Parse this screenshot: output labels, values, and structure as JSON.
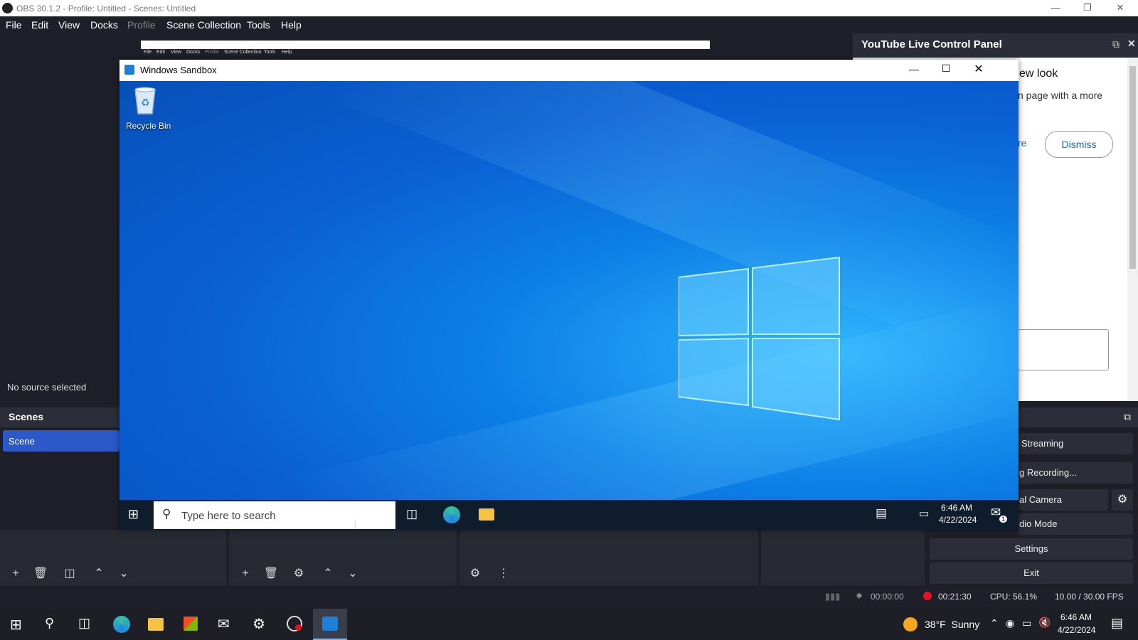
{
  "obs": {
    "window_title": "OBS 30.1.2 - Profile: Untitled - Scenes: Untitled",
    "menu": [
      "File",
      "Edit",
      "View",
      "Docks",
      "Profile",
      "Scene Collection",
      "Tools",
      "Help"
    ],
    "preview_menu": [
      "File",
      "Edit",
      "View",
      "Docks",
      "Profile",
      "Scene Collection",
      "Tools",
      "Help"
    ],
    "no_source": "No source selected",
    "scenes_title": "Scenes",
    "scene_item": "Scene",
    "youtube_panel": {
      "title": "YouTube Live Control Panel",
      "headline_partial": "ew look",
      "text_partial": "n page with a more",
      "link_partial": "re",
      "dismiss": "Dismiss"
    },
    "controls": {
      "streaming": "Streaming",
      "recording": "g Recording...",
      "virtual_camera": "al Camera",
      "studio_mode": "dio Mode",
      "settings": "Settings",
      "exit": "Exit"
    },
    "status": {
      "stream_time": "00:00:00",
      "rec_time": "00:21:30",
      "cpu": "CPU: 56.1%",
      "fps": "10.00 / 30.00 FPS"
    }
  },
  "sandbox": {
    "title": "Windows Sandbox",
    "recycle_bin": "Recycle Bin",
    "search_placeholder": "Type here to search",
    "time": "6:46 AM",
    "date": "4/22/2024",
    "notification_count": "1"
  },
  "host_taskbar": {
    "weather": "38°F  Sunny",
    "time": "6:46 AM",
    "date": "4/22/2024"
  },
  "colors": {
    "obs_bg": "#1e1f29",
    "scene_selected": "#2d59c8",
    "rec_red": "#e81123",
    "desktop_blue": "#0c7fe6"
  }
}
